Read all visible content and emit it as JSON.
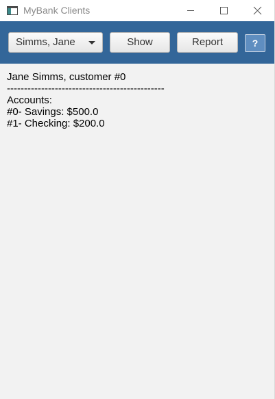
{
  "window": {
    "title": "MyBank Clients",
    "controls": {
      "minimize": "minimize-icon",
      "maximize": "maximize-icon",
      "close": "close-icon"
    }
  },
  "toolbar": {
    "background": "#336699",
    "customer_select": {
      "value": "Simms, Jane",
      "icon": "chevron-down-icon"
    },
    "show_label": "Show",
    "report_label": "Report",
    "help_label": "?"
  },
  "report": {
    "header": "Jane Simms, customer #0",
    "separator": "----------------------------------------------",
    "accounts_label": "Accounts:",
    "accounts": [
      "#0- Savings: $500.0",
      "#1- Checking: $200.0"
    ]
  }
}
